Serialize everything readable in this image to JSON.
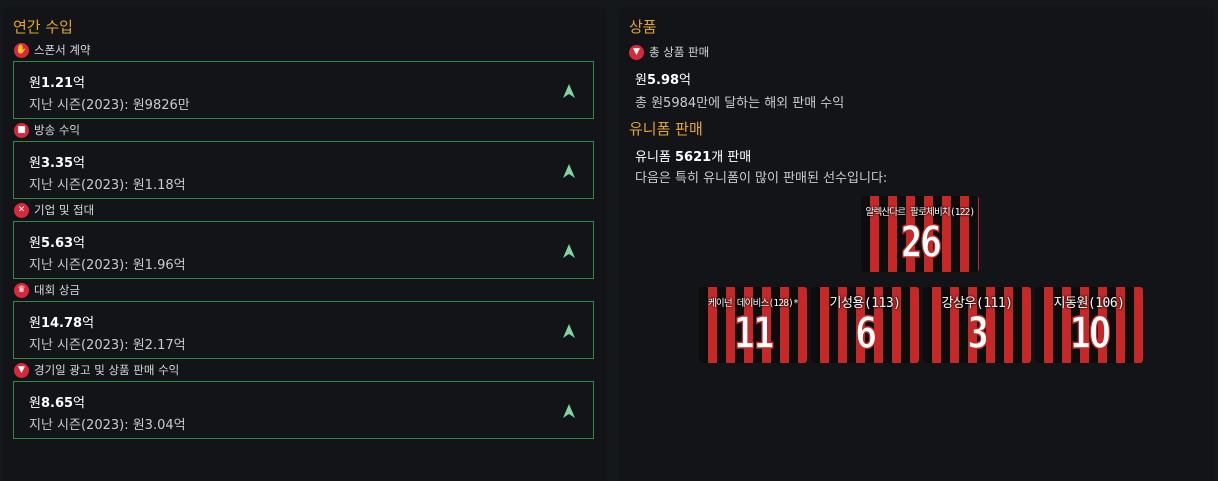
{
  "left": {
    "title": "연간 수입",
    "categories": [
      {
        "icon": "handshake-icon",
        "label": "스폰서 계약",
        "amount_prefix": "원",
        "amount": "1.21",
        "amount_suffix": "억",
        "previous": "지난 시즌(2023): 원9826만"
      },
      {
        "icon": "camera-icon",
        "label": "방송 수익",
        "amount_prefix": "원",
        "amount": "3.35",
        "amount_suffix": "억",
        "previous": "지난 시즌(2023): 원1.18억"
      },
      {
        "icon": "cutlery-icon",
        "label": "기업 및 접대",
        "amount_prefix": "원",
        "amount": "5.63",
        "amount_suffix": "억",
        "previous": "지난 시즌(2023): 원1.96억"
      },
      {
        "icon": "trophy-icon",
        "label": "대회 상금",
        "amount_prefix": "원",
        "amount": "14.78",
        "amount_suffix": "억",
        "previous": "지난 시즌(2023): 원2.17억"
      },
      {
        "icon": "shirt-icon",
        "label": "경기일 광고 및 상품 판매 수익",
        "amount_prefix": "원",
        "amount": "8.65",
        "amount_suffix": "억",
        "previous": "지난 시즌(2023): 원3.04억"
      }
    ]
  },
  "right": {
    "title": "상품",
    "merch_label": "총 상품 판매",
    "merch_amount_prefix": "원",
    "merch_amount": "5.98",
    "merch_amount_suffix": "억",
    "merch_desc": "총 원5984만에 달하는 해외 판매 수익",
    "uniform_title": "유니폼 판매",
    "uniform_count_prefix": "유니폼 ",
    "uniform_count": "5621",
    "uniform_count_suffix": "개 판매",
    "uniform_desc": "다음은 특히 유니폼이 많이 판매된 선수입니다:",
    "jerseys": [
      {
        "name": "알렉산다르 팔로체비치(122)",
        "number": "26"
      },
      {
        "name": "케이넌 데이비스(128)*",
        "number": "11"
      },
      {
        "name": "기성용(113)",
        "number": "6"
      },
      {
        "name": "강상우(111)",
        "number": "3"
      },
      {
        "name": "지동원(106)",
        "number": "10"
      }
    ]
  },
  "colors": {
    "accent": "#e0a62e",
    "card_border": "#2d8c3f",
    "trend_up": "#7fd6a0",
    "icon_bg": "#d8283d",
    "jersey_red": "#c62828",
    "jersey_black": "#0d0d0d"
  }
}
